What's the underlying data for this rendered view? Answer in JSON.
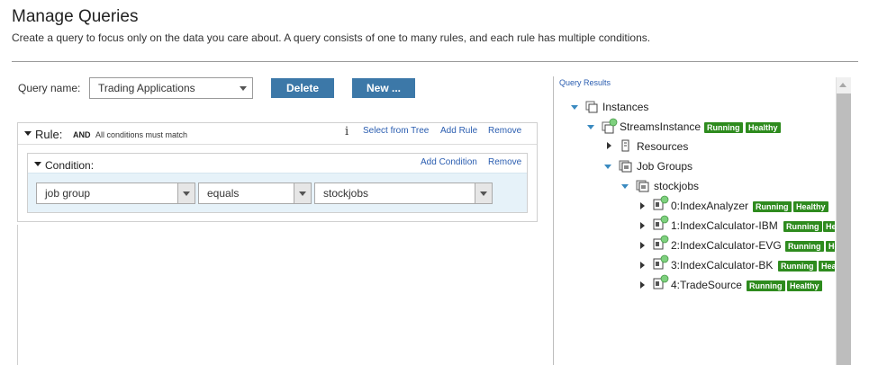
{
  "page": {
    "title": "Manage Queries",
    "subtitle": "Create a query to focus only on the data you care about. A query consists of one to many rules, and each rule has multiple conditions."
  },
  "query": {
    "name_label": "Query name:",
    "name_value": "Trading Applications",
    "delete_label": "Delete",
    "new_label": "New ..."
  },
  "rule": {
    "label": "Rule:",
    "mode": "AND",
    "mode_desc": "All conditions must match",
    "info_glyph": "i",
    "select_from_tree": "Select from Tree",
    "add_rule": "Add Rule",
    "remove": "Remove"
  },
  "condition": {
    "label": "Condition:",
    "add_condition": "Add Condition",
    "remove": "Remove",
    "field": "job group",
    "operator": "equals",
    "value": "stockjobs"
  },
  "results": {
    "label": "Query Results",
    "instances": "Instances",
    "instance_name": "StreamsInstance",
    "resources": "Resources",
    "job_groups": "Job Groups",
    "group_name": "stockjobs",
    "status_running": "Running",
    "status_healthy": "Healthy",
    "jobs": [
      {
        "name": "0:IndexAnalyzer"
      },
      {
        "name": "1:IndexCalculator-IBM"
      },
      {
        "name": "2:IndexCalculator-EVG"
      },
      {
        "name": "3:IndexCalculator-BK"
      },
      {
        "name": "4:TradeSource"
      }
    ]
  },
  "colors": {
    "button": "#3c78a8",
    "link": "#2a5db0",
    "badge": "#2e8b1e",
    "condition_bg": "#e6f2f9",
    "health_dot": "#7ed07e"
  }
}
